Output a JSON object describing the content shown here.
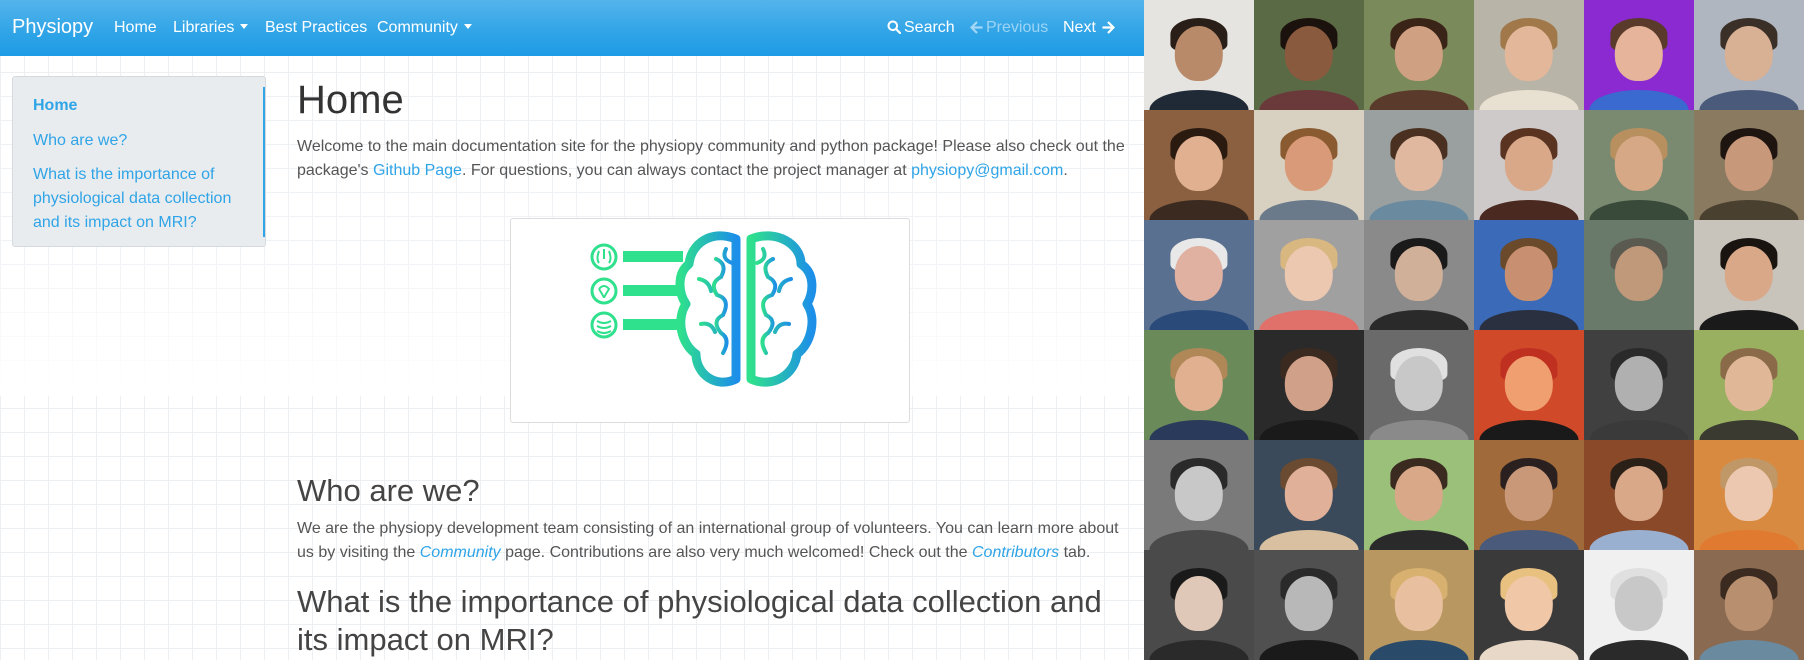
{
  "nav": {
    "brand": "Physiopy",
    "items": [
      {
        "label": "Home"
      },
      {
        "label": "Libraries"
      },
      {
        "label": "Best Practices"
      },
      {
        "label": "Community"
      }
    ],
    "search_label": "Search",
    "previous_label": "Previous",
    "next_label": "Next"
  },
  "sidebar": {
    "items": [
      {
        "label": "Home"
      },
      {
        "label": "Who are we?"
      },
      {
        "label": "What is the importance of physiological data collection and its impact on MRI?"
      }
    ]
  },
  "main": {
    "title": "Home",
    "intro_1": "Welcome to the main documentation site for the physiopy community and python package! Please also check out the package's ",
    "github_link": "Github Page",
    "intro_2": ". For questions, you can always contact the project manager at ",
    "email_link": "physiopy@gmail.com",
    "intro_3": ".",
    "who_title": "Who are we?",
    "who_1": "We are the physiopy development team consisting of an international group of volunteers. You can learn more about us by visiting the ",
    "community_link": "Community",
    "who_2": " page. Contributions are also very much welcomed! Check out the ",
    "contributors_link": "Contributors",
    "who_3": " tab.",
    "importance_title": "What is the importance of physiological data collection and its impact on MRI?"
  },
  "colors": {
    "accent": "#2fa4e7",
    "logo_green": "#2fe08c",
    "logo_blue": "#1d8fe8"
  },
  "contributors_grid": {
    "rows": 6,
    "columns": 6,
    "tiles": [
      {
        "bg": "#e6e4e0",
        "skin": "#b98a6a",
        "hair": "#2a1f18",
        "shirt": "#1f2a36"
      },
      {
        "bg": "#5a6a45",
        "skin": "#8a5a3f",
        "hair": "#1c120d",
        "shirt": "#6a3a3a"
      },
      {
        "bg": "#7a8a5a",
        "skin": "#d0a083",
        "hair": "#3a2418",
        "shirt": "#5a3a2a"
      },
      {
        "bg": "#b8b4a8",
        "skin": "#e2b79a",
        "hair": "#a0784a",
        "shirt": "#e8e0d0"
      },
      {
        "bg": "#8a2ad0",
        "skin": "#e6b49a",
        "hair": "#5a3a2a",
        "shirt": "#3a6ad0"
      },
      {
        "bg": "#b0b6c0",
        "skin": "#d8b094",
        "hair": "#3a3028",
        "shirt": "#4a5a7a"
      },
      {
        "bg": "#8a6040",
        "skin": "#e0b090",
        "hair": "#2a1a10",
        "shirt": "#3a2a20"
      },
      {
        "bg": "#d8d0c0",
        "skin": "#d89a78",
        "hair": "#8a5a30",
        "shirt": "#6a7a8a"
      },
      {
        "bg": "#9aa0a0",
        "skin": "#e0b8a0",
        "hair": "#4a3020",
        "shirt": "#6a8aa0"
      },
      {
        "bg": "#cfcaca",
        "skin": "#d8a888",
        "hair": "#5a3420",
        "shirt": "#4a2a20"
      },
      {
        "bg": "#7a8a70",
        "skin": "#d6a886",
        "hair": "#b89060",
        "shirt": "#3a4a3a"
      },
      {
        "bg": "#8a7a60",
        "skin": "#c8987a",
        "hair": "#1e1410",
        "shirt": "#4a4030"
      },
      {
        "bg": "#5a7090",
        "skin": "#e0b0a0",
        "hair": "#e8e8e8",
        "shirt": "#2a4a7a"
      },
      {
        "bg": "#a0a0a0",
        "skin": "#ecc8b0",
        "hair": "#d8b880",
        "shirt": "#e0706a"
      },
      {
        "bg": "#8a8a8a",
        "skin": "#d0b098",
        "hair": "#1a1a1a",
        "shirt": "#2a2a2a"
      },
      {
        "bg": "#3a6ab8",
        "skin": "#c89070",
        "hair": "#6a4a2a",
        "shirt": "#2a3040"
      },
      {
        "bg": "#6a7a6a",
        "skin": "#c0987a",
        "hair": "#5a5a50",
        "shirt": "#6a7a6a"
      },
      {
        "bg": "#c8c4bc",
        "skin": "#d8a888",
        "hair": "#1a1410",
        "shirt": "#1a1a1a"
      },
      {
        "bg": "#6a8a5a",
        "skin": "#e0b090",
        "hair": "#b08858",
        "shirt": "#2a3a5a"
      },
      {
        "bg": "#2a2a2a",
        "skin": "#d0a088",
        "hair": "#3a2a20",
        "shirt": "#1a1a1a"
      },
      {
        "bg": "#6a6a6a",
        "skin": "#c8c8c8",
        "hair": "#e0e0e0",
        "shirt": "#8a8a8a"
      },
      {
        "bg": "#d04a2a",
        "skin": "#f0a070",
        "hair": "#c03020",
        "shirt": "#1a1a1a"
      },
      {
        "bg": "#404040",
        "skin": "#b0b0b0",
        "hair": "#2a2a2a",
        "shirt": "#3a3a3a"
      },
      {
        "bg": "#98b060",
        "skin": "#e0b898",
        "hair": "#8a6a48",
        "shirt": "#3a3a30"
      },
      {
        "bg": "#7a7a7a",
        "skin": "#c8c8c8",
        "hair": "#2a2a2a",
        "shirt": "#4a4a4a"
      },
      {
        "bg": "#3a4a5a",
        "skin": "#e0b098",
        "hair": "#6a4a30",
        "shirt": "#d8c0a0"
      },
      {
        "bg": "#9ac07a",
        "skin": "#d8a888",
        "hair": "#3a2a20",
        "shirt": "#2a2a2a"
      },
      {
        "bg": "#a06a3a",
        "skin": "#c89878",
        "hair": "#2a2020",
        "shirt": "#4a5a7a"
      },
      {
        "bg": "#8a4a2a",
        "skin": "#d8a888",
        "hair": "#2a2018",
        "shirt": "#9ab0d0"
      },
      {
        "bg": "#d88a40",
        "skin": "#ecc8b0",
        "hair": "#c09868",
        "shirt": "#e07a30"
      },
      {
        "bg": "#4a4a4a",
        "skin": "#e0c8b8",
        "hair": "#1a1a1a",
        "shirt": "#2a2a2a"
      },
      {
        "bg": "#505050",
        "skin": "#b8b8b8",
        "hair": "#2a2a2a",
        "shirt": "#1a1a1a"
      },
      {
        "bg": "#b89860",
        "skin": "#e8c0a0",
        "hair": "#d8b070",
        "shirt": "#2a4a6a"
      },
      {
        "bg": "#3a3a3a",
        "skin": "#f0c8a8",
        "hair": "#e8c080",
        "shirt": "#e8d8c8"
      },
      {
        "bg": "#f0f0f0",
        "skin": "#c8c8c8",
        "hair": "#e0e0e0",
        "shirt": "#2a2a2a"
      },
      {
        "bg": "#8a6a50",
        "skin": "#b89070",
        "hair": "#3a2a20",
        "shirt": "#6a8aa0"
      }
    ]
  }
}
